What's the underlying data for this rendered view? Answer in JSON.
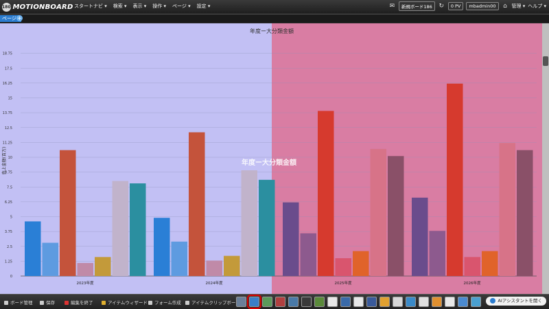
{
  "header": {
    "logo_badge": "180",
    "logo_text": "MOTIONBOARD",
    "menu": [
      "スタートナビ ▾",
      "検索 ▾",
      "表示 ▾",
      "操作 ▾",
      "ページ ▾",
      "設定 ▾"
    ],
    "board_name": "新規ボード186",
    "pv": "0 PV",
    "user": "mbadmin00",
    "admin_menu": "管理 ▾",
    "help_menu": "ヘルプ ▾"
  },
  "tabs": {
    "page_tab": "ページ1",
    "add_icon": "+"
  },
  "chart_data": {
    "type": "bar",
    "title": "年度ー大分類金額",
    "ylabel": "売上金額(百万)",
    "ylim": [
      0,
      20
    ],
    "yticks": [
      "0",
      "1.25",
      "2.5",
      "3.75",
      "5",
      "6.25",
      "7.5",
      "8.75",
      "10",
      "11.25",
      "12.5",
      "13.75",
      "15",
      "16.25",
      "17.5",
      "18.75"
    ],
    "categories": [
      "2023年度",
      "2024年度",
      "2025年度",
      "2026年度"
    ],
    "series": [
      {
        "color_left": "#2a7fd6",
        "color_right": "#6a4c8c",
        "values": [
          4.6,
          4.9,
          6.2,
          6.6
        ]
      },
      {
        "color_left": "#5e9be0",
        "color_right": "#8d5a8e",
        "values": [
          2.8,
          2.9,
          3.6,
          3.8
        ]
      },
      {
        "color_left": "#c4533b",
        "color_right": "#d63a2e",
        "values": [
          10.6,
          12.1,
          13.9,
          16.2
        ]
      },
      {
        "color_left": "#c08aa8",
        "color_right": "#d9556e",
        "values": [
          1.1,
          1.3,
          1.5,
          1.6
        ]
      },
      {
        "color_left": "#c39a3a",
        "color_right": "#e0632a",
        "values": [
          1.6,
          1.7,
          2.1,
          2.1
        ]
      },
      {
        "color_left": "#c1b3cb",
        "color_right": "#d77388",
        "values": [
          8.0,
          8.9,
          10.7,
          11.2
        ]
      },
      {
        "color_left": "#2b8fa0",
        "color_right": "#8a5068",
        "values": [
          7.8,
          8.1,
          10.1,
          10.6
        ]
      }
    ],
    "watermark": "年度ー大分類金額"
  },
  "footer": {
    "items": [
      "ボード管理",
      "保存",
      "編集を終了",
      "アイテムウィザード",
      "フォーム作成",
      "アイテムクリップボード"
    ],
    "ai_button": "AIアシスタントを開く"
  },
  "colors": {
    "accent": "#2b7ccf",
    "left_bg": "#c2c0f4",
    "right_bg": "#d97da3"
  }
}
